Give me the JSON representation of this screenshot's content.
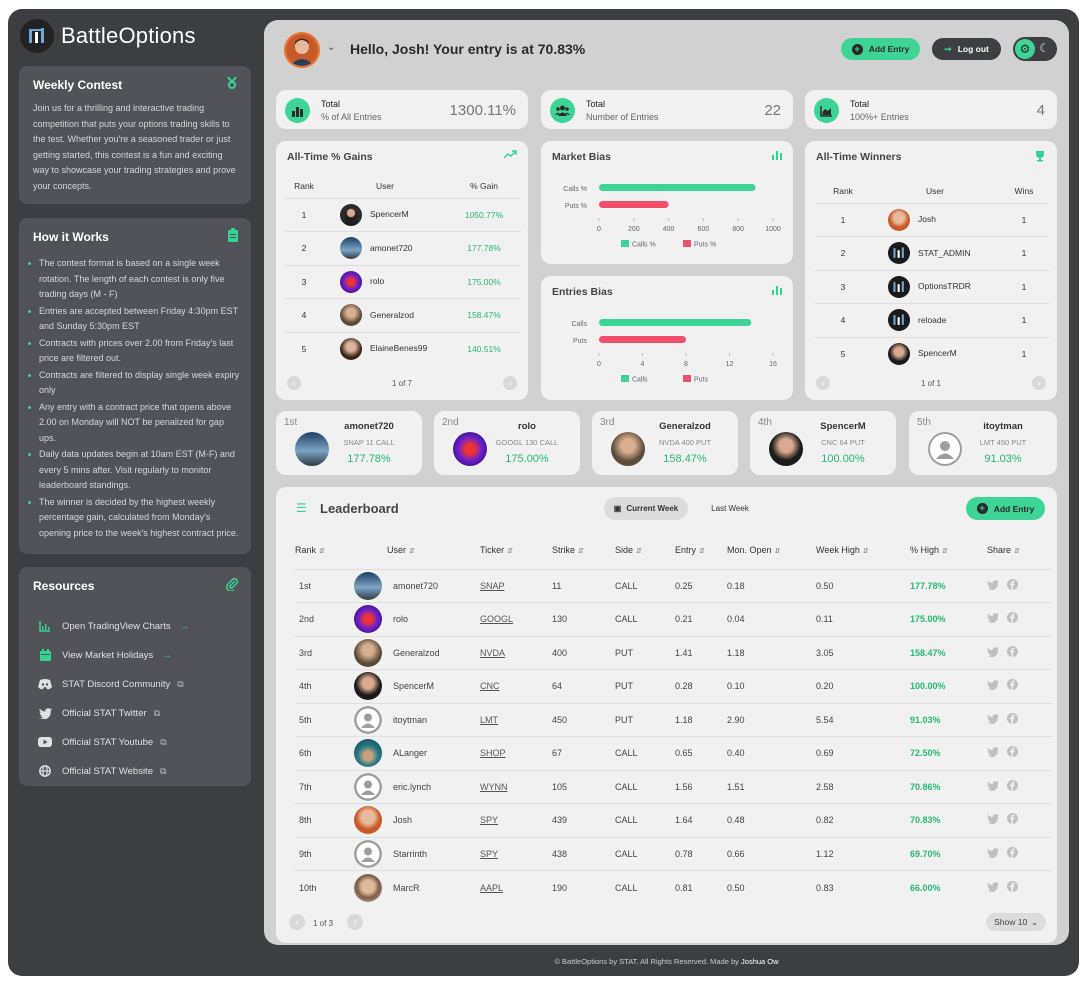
{
  "app": {
    "title": "BattleOptions"
  },
  "sidebar": {
    "weekly": {
      "title": "Weekly Contest",
      "text": "Join us for a thrilling and interactive trading competition that puts your options trading skills to the test. Whether you're a seasoned trader or just getting started, this contest is a fun and exciting way to showcase your trading strategies and prove your concepts."
    },
    "how": {
      "title": "How it Works",
      "items": [
        "The contest format is based on a single week rotation. The length of each contest is only five trading days (M - F)",
        "Entries are accepted between Friday 4:30pm EST and Sunday 5:30pm EST",
        "Contracts with prices over 2.00 from Friday's last price are filtered out.",
        "Contracts are filtered to display single week expiry only",
        "Any entry with a contract price that opens above 2.00 on Monday will NOT be penalized for gap ups.",
        "Daily data updates begin at 10am EST (M-F) and every 5 mins after. Visit regularly to monitor leaderboard standings.",
        "The winner is decided by the highest weekly percentage gain, calculated from Monday's opening price to the week's highest contract price."
      ]
    },
    "resources": {
      "title": "Resources",
      "items": [
        {
          "label": "Open TradingView Charts",
          "icon": "chart-icon",
          "suffix": "→"
        },
        {
          "label": "View Market Holidays",
          "icon": "calendar-icon",
          "suffix": "→"
        },
        {
          "label": "STAT Discord Community",
          "icon": "discord-icon",
          "suffix": "⧉"
        },
        {
          "label": "Official STAT Twitter",
          "icon": "twitter-icon",
          "suffix": "⧉"
        },
        {
          "label": "Official STAT Youtube",
          "icon": "youtube-icon",
          "suffix": "⧉"
        },
        {
          "label": "Official STAT Website",
          "icon": "globe-icon",
          "suffix": "⧉"
        }
      ]
    }
  },
  "header": {
    "greeting": "Hello, Josh! Your entry is at 70.83%",
    "add_entry": "Add Entry",
    "logout": "Log out"
  },
  "stats": [
    {
      "t1": "Total",
      "t2": "% of All Entries",
      "value": "1300.11%"
    },
    {
      "t1": "Total",
      "t2": "Number of Entries",
      "value": "22"
    },
    {
      "t1": "Total",
      "t2": "100%+ Entries",
      "value": "4"
    }
  ],
  "gains": {
    "title": "All-Time % Gains",
    "headers": [
      "Rank",
      "User",
      "% Gain"
    ],
    "rows": [
      {
        "rank": "1",
        "user": "SpencerM",
        "gain": "1050.77%"
      },
      {
        "rank": "2",
        "user": "amonet720",
        "gain": "177.78%"
      },
      {
        "rank": "3",
        "user": "rolo",
        "gain": "175.00%"
      },
      {
        "rank": "4",
        "user": "Generalzod",
        "gain": "158.47%"
      },
      {
        "rank": "5",
        "user": "ElaineBenes99",
        "gain": "140.51%"
      }
    ],
    "page": "1 of 7"
  },
  "market_bias": {
    "title": "Market Bias",
    "labels": [
      "Calls %",
      "Puts %"
    ],
    "values": [
      900,
      400
    ],
    "ticks": [
      "0",
      "200",
      "400",
      "600",
      "800",
      "1000"
    ],
    "xmax": 1000,
    "legend": [
      "Calls %",
      "Puts %"
    ]
  },
  "entries_bias": {
    "title": "Entries Bias",
    "labels": [
      "Calls",
      "Puts"
    ],
    "values": [
      14,
      8
    ],
    "ticks": [
      "0",
      "4",
      "8",
      "12",
      "16"
    ],
    "xmax": 16,
    "legend": [
      "Calls",
      "Puts"
    ]
  },
  "winners": {
    "title": "All-Time Winners",
    "headers": [
      "Rank",
      "User",
      "Wins"
    ],
    "rows": [
      {
        "rank": "1",
        "user": "Josh",
        "wins": "1"
      },
      {
        "rank": "2",
        "user": "STAT_ADMIN",
        "wins": "1"
      },
      {
        "rank": "3",
        "user": "OptionsTRDR",
        "wins": "1"
      },
      {
        "rank": "4",
        "user": "reloade",
        "wins": "1"
      },
      {
        "rank": "5",
        "user": "SpencerM",
        "wins": "1"
      }
    ],
    "page": "1 of 1"
  },
  "top5": [
    {
      "pos": "1st",
      "name": "amonet720",
      "sub": "SNAP 11 CALL",
      "pct": "177.78%"
    },
    {
      "pos": "2nd",
      "name": "rolo",
      "sub": "GOOGL 130 CALL",
      "pct": "175.00%"
    },
    {
      "pos": "3rd",
      "name": "Generalzod",
      "sub": "NVDA 400 PUT",
      "pct": "158.47%"
    },
    {
      "pos": "4th",
      "name": "SpencerM",
      "sub": "CNC 64 PUT",
      "pct": "100.00%"
    },
    {
      "pos": "5th",
      "name": "itoytman",
      "sub": "LMT 450 PUT",
      "pct": "91.03%"
    }
  ],
  "leaderboard": {
    "title": "Leaderboard",
    "tab_current": "Current Week",
    "tab_last": "Last Week",
    "add_entry": "Add Entry",
    "headers": [
      "Rank",
      "User",
      "Ticker",
      "Strike",
      "Side",
      "Entry",
      "Mon. Open",
      "Week High",
      "% High",
      "Share"
    ],
    "rows": [
      {
        "rank": "1st",
        "user": "amonet720",
        "ticker": "SNAP",
        "strike": "11",
        "side": "CALL",
        "entry": "0.25",
        "open": "0.18",
        "high": "0.50",
        "pct": "177.78%"
      },
      {
        "rank": "2nd",
        "user": "rolo",
        "ticker": "GOOGL",
        "strike": "130",
        "side": "CALL",
        "entry": "0.21",
        "open": "0.04",
        "high": "0.11",
        "pct": "175.00%"
      },
      {
        "rank": "3rd",
        "user": "Generalzod",
        "ticker": "NVDA",
        "strike": "400",
        "side": "PUT",
        "entry": "1.41",
        "open": "1.18",
        "high": "3.05",
        "pct": "158.47%"
      },
      {
        "rank": "4th",
        "user": "SpencerM",
        "ticker": "CNC",
        "strike": "64",
        "side": "PUT",
        "entry": "0.28",
        "open": "0.10",
        "high": "0.20",
        "pct": "100.00%"
      },
      {
        "rank": "5th",
        "user": "itoytman",
        "ticker": "LMT",
        "strike": "450",
        "side": "PUT",
        "entry": "1.18",
        "open": "2.90",
        "high": "5.54",
        "pct": "91.03%"
      },
      {
        "rank": "6th",
        "user": "ALanger",
        "ticker": "SHOP",
        "strike": "67",
        "side": "CALL",
        "entry": "0.65",
        "open": "0.40",
        "high": "0.69",
        "pct": "72.50%"
      },
      {
        "rank": "7th",
        "user": "eric.lynch",
        "ticker": "WYNN",
        "strike": "105",
        "side": "CALL",
        "entry": "1.56",
        "open": "1.51",
        "high": "2.58",
        "pct": "70.86%"
      },
      {
        "rank": "8th",
        "user": "Josh",
        "ticker": "SPY",
        "strike": "439",
        "side": "CALL",
        "entry": "1.64",
        "open": "0.48",
        "high": "0.82",
        "pct": "70.83%"
      },
      {
        "rank": "9th",
        "user": "Starrinth",
        "ticker": "SPY",
        "strike": "438",
        "side": "CALL",
        "entry": "0.78",
        "open": "0.66",
        "high": "1.12",
        "pct": "69.70%"
      },
      {
        "rank": "10th",
        "user": "MarcR",
        "ticker": "AAPL",
        "strike": "190",
        "side": "CALL",
        "entry": "0.81",
        "open": "0.50",
        "high": "0.83",
        "pct": "66.00%"
      }
    ],
    "page": "1 of 3",
    "show": "Show 10"
  },
  "footer": {
    "text": "© BattleOptions by STAT. All Rights Reserved.  Made by",
    "author": "Joshua Ow"
  },
  "colors": {
    "accent": "#3dd496",
    "puts": "#f0506e",
    "sidebar_bg": "#3d3e42",
    "main_bg": "#d1d1d1"
  }
}
